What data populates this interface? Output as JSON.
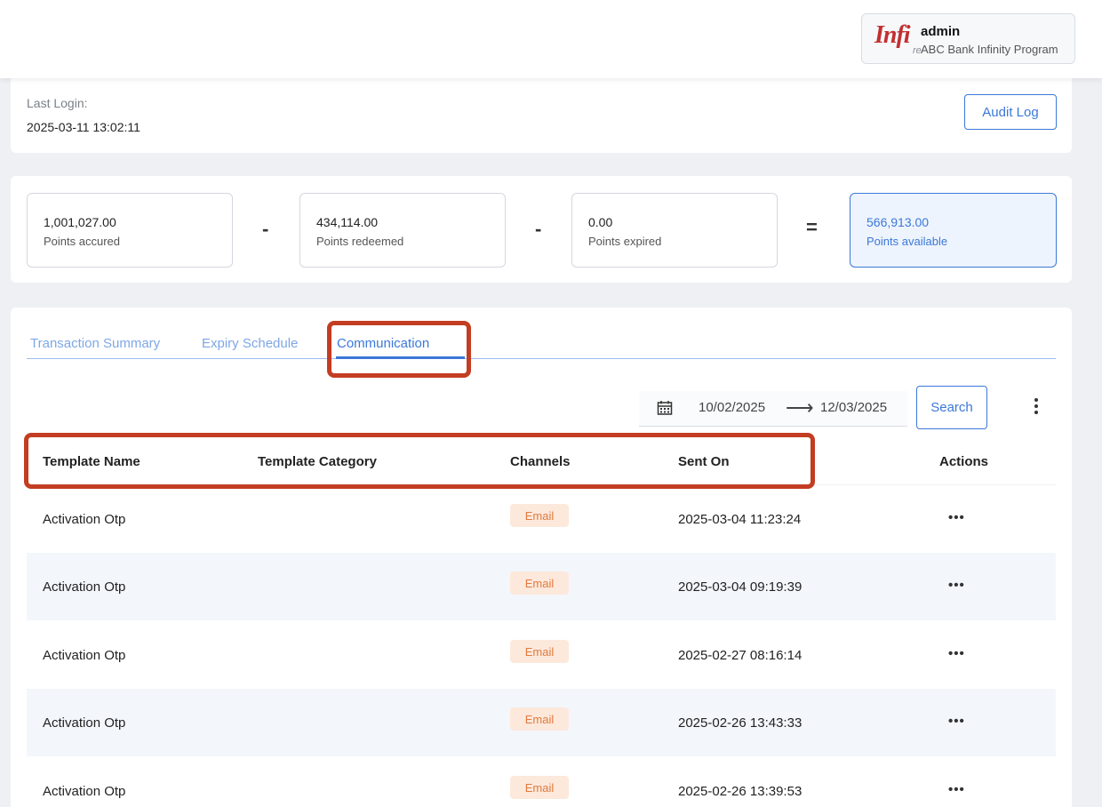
{
  "header": {
    "logo_text": "Infi",
    "logo_sub": "re",
    "user_name": "admin",
    "program_name": "ABC Bank Infinity Program"
  },
  "login": {
    "label": "Last Login:",
    "value": "2025-03-11 13:02:11",
    "audit_label": "Audit Log"
  },
  "points": {
    "accrued": {
      "value": "1,001,027.00",
      "label": "Points accured"
    },
    "minus1": "-",
    "redeemed": {
      "value": "434,114.00",
      "label": "Points redeemed"
    },
    "minus2": "-",
    "expired": {
      "value": "0.00",
      "label": "Points expired"
    },
    "equals": "=",
    "available": {
      "value": "566,913.00",
      "label": "Points available"
    }
  },
  "tabs": [
    {
      "label": "Transaction Summary",
      "active": false
    },
    {
      "label": "Expiry Schedule",
      "active": false
    },
    {
      "label": "Communication",
      "active": true
    }
  ],
  "filters": {
    "date_start": "10/02/2025",
    "arrow": "⟶",
    "date_end": "12/03/2025",
    "search_label": "Search"
  },
  "table": {
    "headers": [
      "Template Name",
      "Template Category",
      "Channels",
      "Sent On",
      "Actions"
    ],
    "rows": [
      {
        "template_name": "Activation Otp",
        "category": "",
        "channel": "Email",
        "sent_on": "2025-03-04 11:23:24",
        "actions": "•••"
      },
      {
        "template_name": "Activation Otp",
        "category": "",
        "channel": "Email",
        "sent_on": "2025-03-04 09:19:39",
        "actions": "•••"
      },
      {
        "template_name": "Activation Otp",
        "category": "",
        "channel": "Email",
        "sent_on": "2025-02-27 08:16:14",
        "actions": "•••"
      },
      {
        "template_name": "Activation Otp",
        "category": "",
        "channel": "Email",
        "sent_on": "2025-02-26 13:43:33",
        "actions": "•••"
      },
      {
        "template_name": "Activation Otp",
        "category": "",
        "channel": "Email",
        "sent_on": "2025-02-26 13:39:53",
        "actions": "•••"
      }
    ]
  },
  "colors": {
    "accent": "#3b78d8",
    "annotation": "#c33d22",
    "badge_bg": "#fde8dc",
    "badge_text": "#e07b3f",
    "brand_logo": "#c22f2f"
  },
  "icons": [
    "calendar-icon",
    "more-vert-icon",
    "more-horiz-icon",
    "arrow-right-icon"
  ]
}
